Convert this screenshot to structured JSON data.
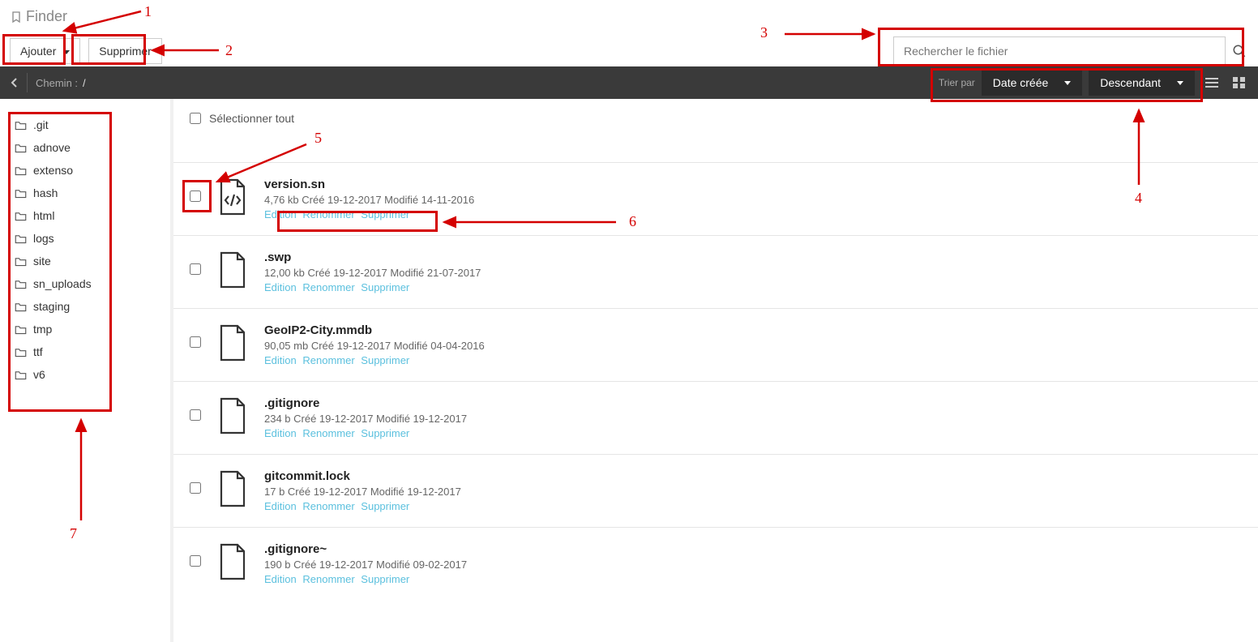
{
  "app": {
    "title": "Finder"
  },
  "toolbar": {
    "add_label": "Ajouter",
    "delete_label": "Supprimer"
  },
  "search": {
    "placeholder": "Rechercher le fichier"
  },
  "pathbar": {
    "path_label": "Chemin :",
    "path_value": "/",
    "sort_label": "Trier par",
    "sort_field": "Date créée",
    "sort_order": "Descendant"
  },
  "sidebar": {
    "items": [
      {
        "label": ".git"
      },
      {
        "label": "adnove"
      },
      {
        "label": "extenso"
      },
      {
        "label": "hash"
      },
      {
        "label": "html"
      },
      {
        "label": "logs"
      },
      {
        "label": "site"
      },
      {
        "label": "sn_uploads"
      },
      {
        "label": "staging"
      },
      {
        "label": "tmp"
      },
      {
        "label": "ttf"
      },
      {
        "label": "v6"
      }
    ]
  },
  "main": {
    "select_all_label": "Sélectionner tout",
    "actions": {
      "edit": "Edition",
      "rename": "Renommer",
      "delete": "Supprimer"
    },
    "files": [
      {
        "name": "version.sn",
        "meta": "4,76 kb Créé 19-12-2017 Modifié 14-11-2016",
        "type": "code"
      },
      {
        "name": ".swp",
        "meta": "12,00 kb Créé 19-12-2017 Modifié 21-07-2017",
        "type": "file"
      },
      {
        "name": "GeoIP2-City.mmdb",
        "meta": "90,05 mb Créé 19-12-2017 Modifié 04-04-2016",
        "type": "file"
      },
      {
        "name": ".gitignore",
        "meta": "234 b Créé 19-12-2017 Modifié 19-12-2017",
        "type": "file"
      },
      {
        "name": "gitcommit.lock",
        "meta": "17 b Créé 19-12-2017 Modifié 19-12-2017",
        "type": "file"
      },
      {
        "name": ".gitignore~",
        "meta": "190 b Créé 19-12-2017 Modifié 09-02-2017",
        "type": "file"
      }
    ]
  },
  "annotations": {
    "n1": "1",
    "n2": "2",
    "n3": "3",
    "n4": "4",
    "n5": "5",
    "n6": "6",
    "n7": "7"
  }
}
